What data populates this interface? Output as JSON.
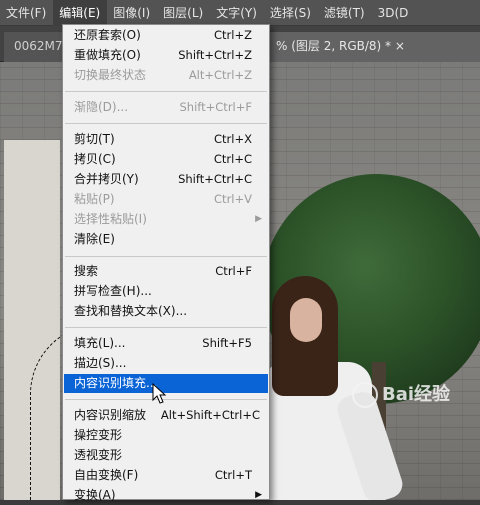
{
  "menubar": {
    "items": [
      {
        "label": "文件(F)"
      },
      {
        "label": "编辑(E)"
      },
      {
        "label": "图像(I)"
      },
      {
        "label": "图层(L)"
      },
      {
        "label": "文字(Y)"
      },
      {
        "label": "选择(S)"
      },
      {
        "label": "滤镜(T)"
      },
      {
        "label": "3D(D"
      }
    ]
  },
  "tabs": {
    "left": "0062M7",
    "right": "% (图层 2, RGB/8) *  ×"
  },
  "edit_menu": {
    "items": [
      {
        "label": "还原套索(O)",
        "shortcut": "Ctrl+Z"
      },
      {
        "label": "重做填充(O)",
        "shortcut": "Shift+Ctrl+Z"
      },
      {
        "label": "切换最终状态",
        "shortcut": "Alt+Ctrl+Z"
      },
      {
        "label": "渐隐(D)...",
        "shortcut": "Shift+Ctrl+F"
      },
      {
        "label": "剪切(T)",
        "shortcut": "Ctrl+X"
      },
      {
        "label": "拷贝(C)",
        "shortcut": "Ctrl+C"
      },
      {
        "label": "合并拷贝(Y)",
        "shortcut": "Shift+Ctrl+C"
      },
      {
        "label": "粘贴(P)",
        "shortcut": "Ctrl+V"
      },
      {
        "label": "选择性粘贴(I)",
        "shortcut": ""
      },
      {
        "label": "清除(E)",
        "shortcut": ""
      },
      {
        "label": "搜索",
        "shortcut": "Ctrl+F"
      },
      {
        "label": "拼写检查(H)...",
        "shortcut": ""
      },
      {
        "label": "查找和替换文本(X)...",
        "shortcut": ""
      },
      {
        "label": "填充(L)...",
        "shortcut": "Shift+F5"
      },
      {
        "label": "描边(S)...",
        "shortcut": ""
      },
      {
        "label": "内容识别填充...",
        "shortcut": ""
      },
      {
        "label": "内容识别缩放",
        "shortcut": "Alt+Shift+Ctrl+C"
      },
      {
        "label": "操控变形",
        "shortcut": ""
      },
      {
        "label": "透视变形",
        "shortcut": ""
      },
      {
        "label": "自由变换(F)",
        "shortcut": "Ctrl+T"
      },
      {
        "label": "变换(A)",
        "shortcut": ""
      }
    ],
    "submenu_arrow": "▶"
  },
  "watermark": {
    "text": "Bai经验"
  },
  "colors": {
    "highlight": "#0a64d6",
    "menu_bg": "#f0f0f0",
    "menubar_bg": "#535353"
  }
}
